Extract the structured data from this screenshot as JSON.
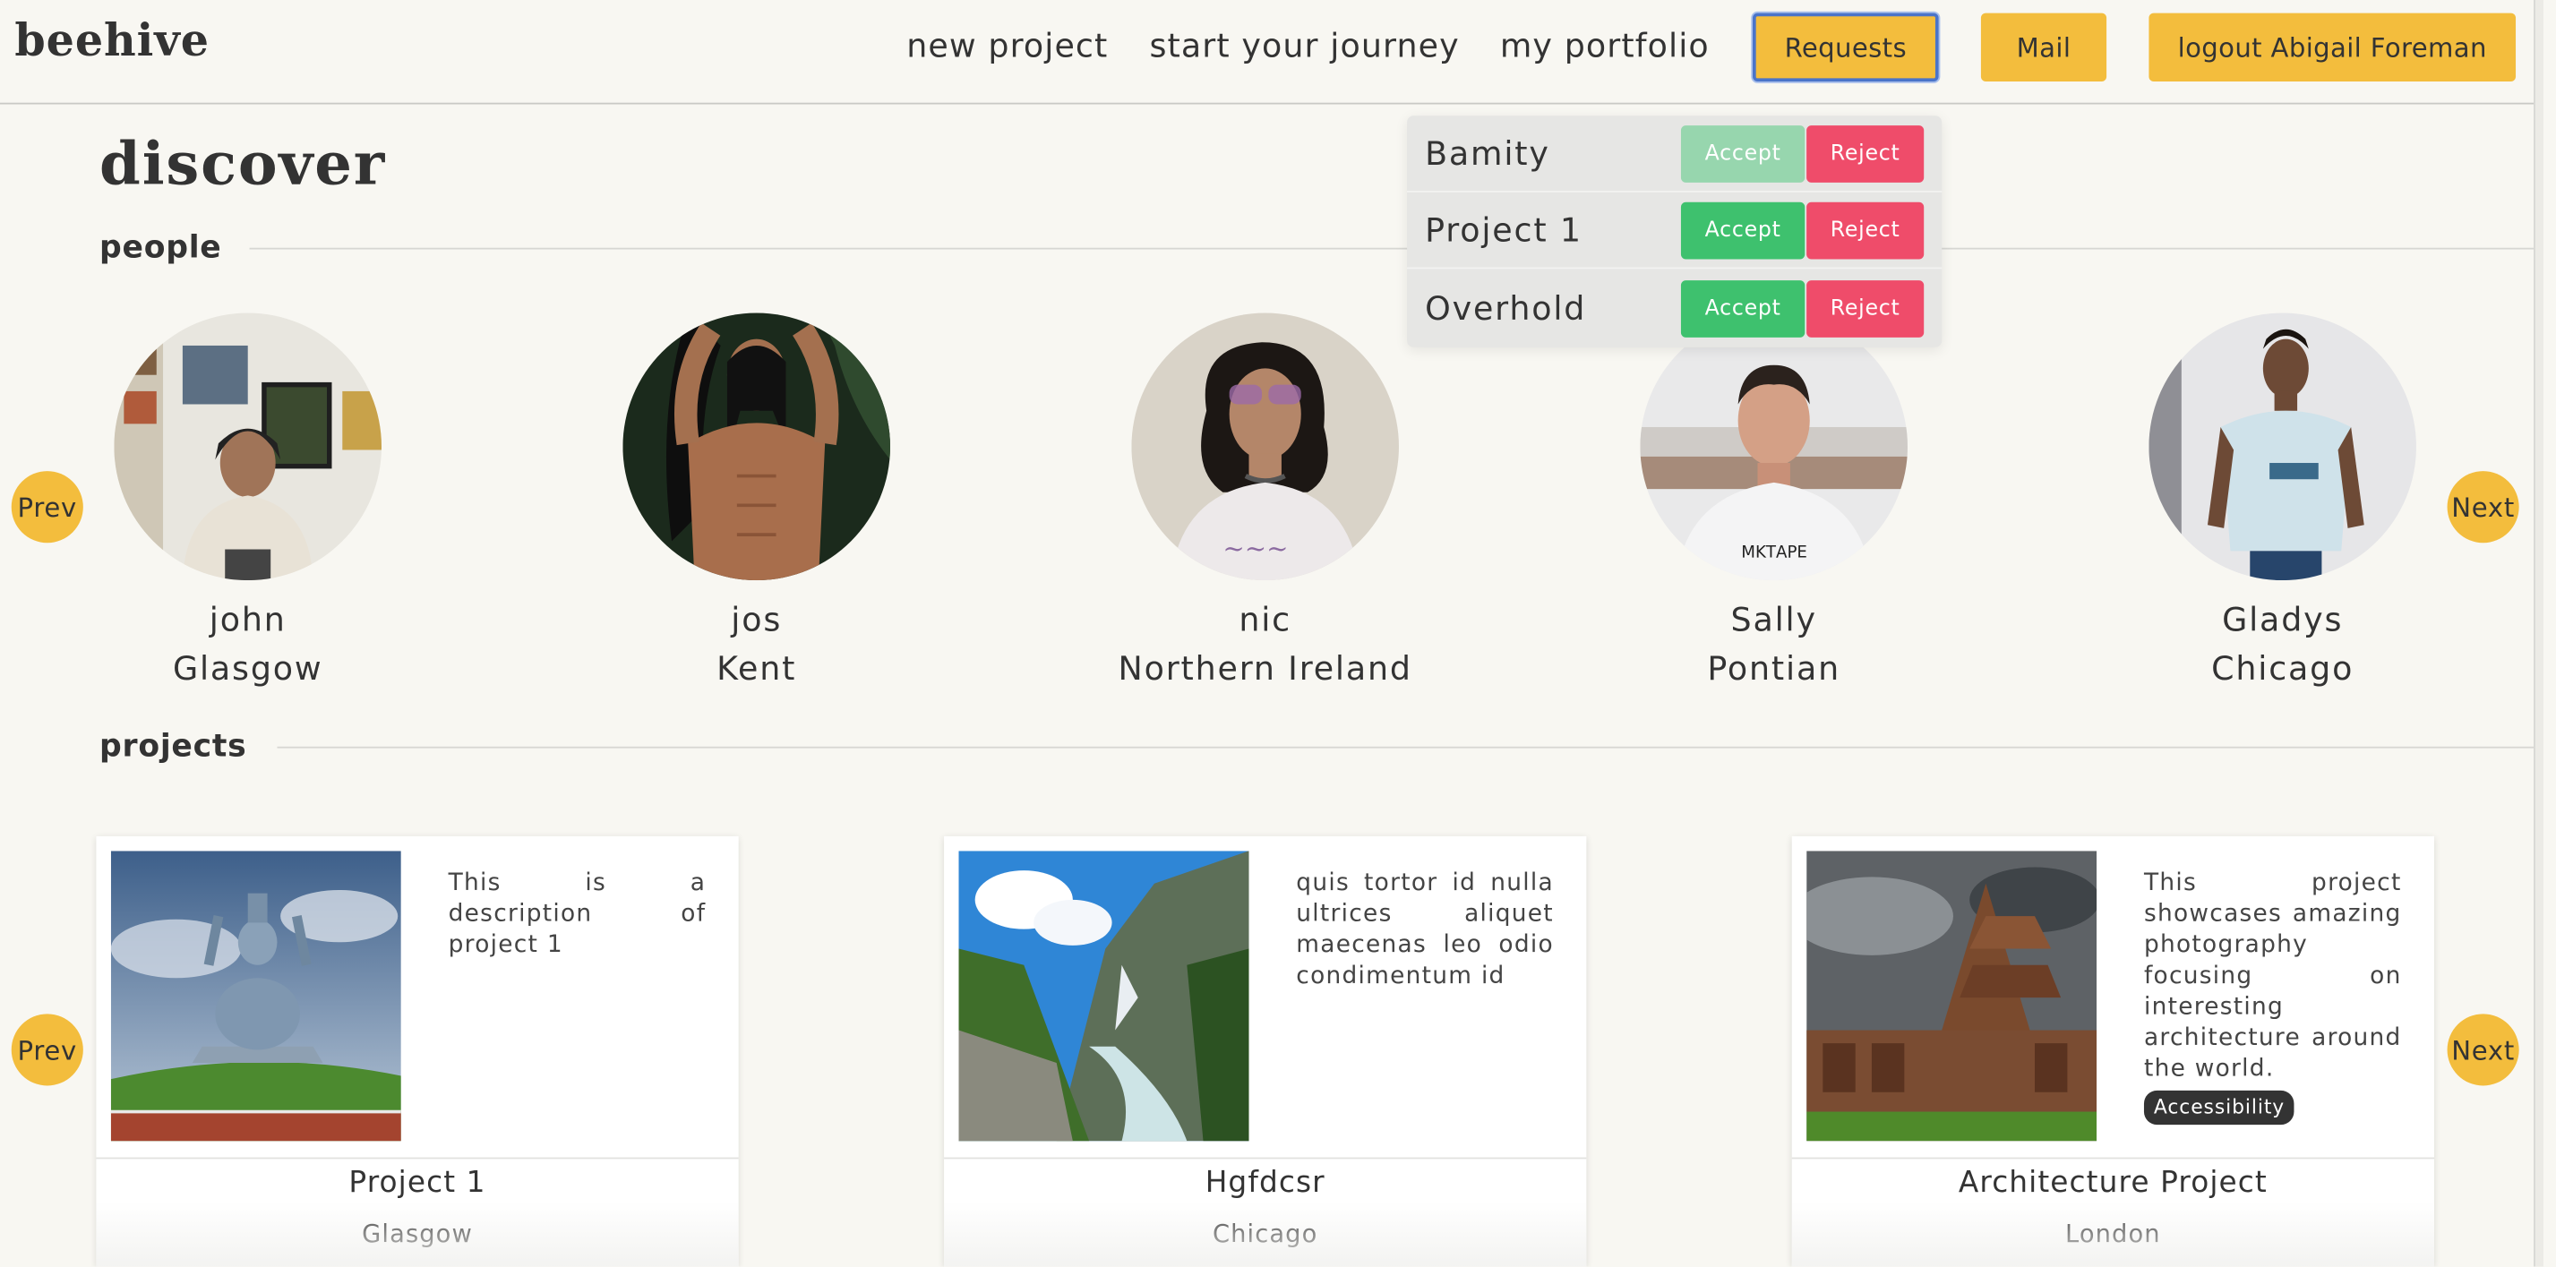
{
  "app": {
    "logo": "beehive"
  },
  "nav": {
    "new_project": "new project",
    "start_journey": "start your journey",
    "portfolio": "my portfolio",
    "requests": "Requests",
    "mail": "Mail",
    "logout": "logout Abigail Foreman"
  },
  "colors": {
    "accent": "#f3bd3d",
    "accept": "#3ec16e",
    "reject": "#ef4c6a",
    "background": "#f8f7f2"
  },
  "requests": {
    "items": [
      {
        "name": "Bamity",
        "accept": "Accept",
        "reject": "Reject"
      },
      {
        "name": "Project 1",
        "accept": "Accept",
        "reject": "Reject"
      },
      {
        "name": "Overhold",
        "accept": "Accept",
        "reject": "Reject"
      }
    ]
  },
  "page": {
    "title": "discover"
  },
  "people": {
    "heading": "people",
    "prev": "Prev",
    "next": "Next",
    "items": [
      {
        "name": "john",
        "location": "Glasgow"
      },
      {
        "name": "jos",
        "location": "Kent"
      },
      {
        "name": "nic",
        "location": "Northern Ireland"
      },
      {
        "name": "Sally",
        "location": "Pontian"
      },
      {
        "name": "Gladys",
        "location": "Chicago"
      }
    ]
  },
  "projects": {
    "heading": "projects",
    "prev": "Prev",
    "next": "Next",
    "items": [
      {
        "title": "Project 1",
        "location": "Glasgow",
        "description": "This is a description of project 1"
      },
      {
        "title": "Hgfdcsr",
        "location": "Chicago",
        "description": "quis tortor id nulla ultrices aliquet maecenas leo odio condimentum id"
      },
      {
        "title": "Architecture Project",
        "location": "London",
        "description": "This project showcases amazing photography focusing on interesting architecture around the world.",
        "tag": "Accessibility"
      }
    ]
  }
}
